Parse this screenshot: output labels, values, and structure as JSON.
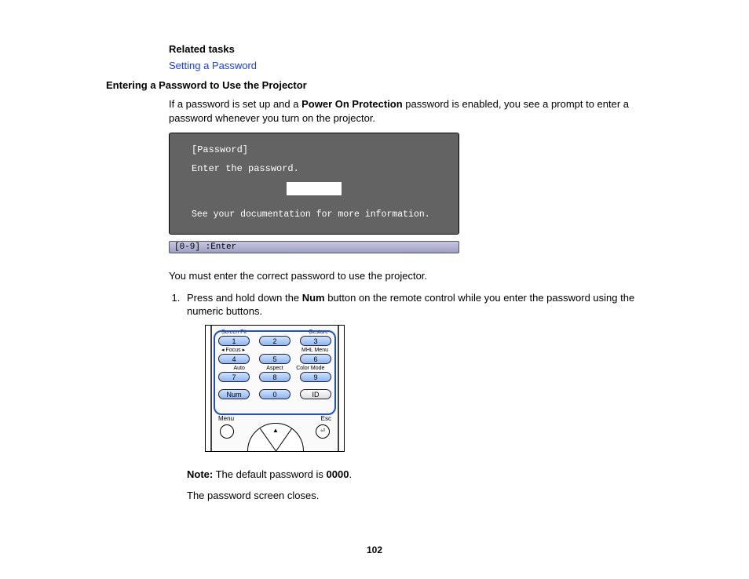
{
  "related_tasks_label": "Related tasks",
  "related_task_link": "Setting a Password",
  "section_heading": "Entering a Password to Use the Projector",
  "intro_pre": "If a password is set up and a ",
  "intro_bold": "Power On Protection",
  "intro_post": " password is enabled, you see a prompt to enter a password whenever you turn on the projector.",
  "osd": {
    "title": "[Password]",
    "prompt": "Enter the password.",
    "footer": "See your documentation for more information.",
    "statusbar": "[0-9] :Enter"
  },
  "after_shot": "You must enter the correct password to use the projector.",
  "step1_pre": "Press and hold down the ",
  "step1_bold": "Num",
  "step1_post": " button on the remote control while you enter the password using the numeric buttons.",
  "remote": {
    "row_labels_top": {
      "left": "Screen Fit",
      "right": "Gesture"
    },
    "row1": [
      "1",
      "2",
      "3"
    ],
    "row_labels_2": {
      "left": "Focus",
      "right": "MHL Menu"
    },
    "row2": [
      "4",
      "5",
      "6"
    ],
    "row_labels_3": [
      "Auto",
      "Aspect",
      "Color Mode"
    ],
    "row3": [
      "7",
      "8",
      "9"
    ],
    "row4": [
      "Num",
      "0",
      "ID"
    ],
    "menu": "Menu",
    "esc": "Esc"
  },
  "note_label": "Note:",
  "note_pre": " The default password is ",
  "note_bold": "0000",
  "note_post": ".",
  "closing": "The password screen closes.",
  "page_number": "102"
}
